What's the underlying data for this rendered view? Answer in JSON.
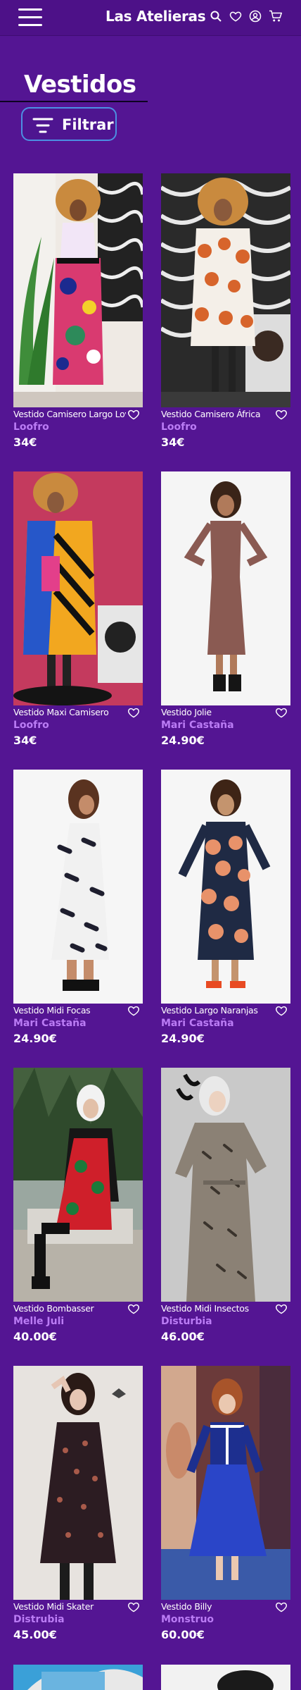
{
  "header": {
    "brand": "Las Atelieras",
    "icons": [
      "menu-icon",
      "search-icon",
      "heart-icon",
      "user-icon",
      "cart-icon"
    ]
  },
  "page": {
    "title": "Vestidos",
    "filter_label": "Filtrar"
  },
  "colors": {
    "background": "#541593",
    "brand_text": "#bb7cf5",
    "filter_border": "#4c90e2"
  },
  "products": [
    {
      "name": "Vestido Camisero Largo Love",
      "brand": "Loofro",
      "price": "34€"
    },
    {
      "name": "Vestido Camisero África",
      "brand": "Loofro",
      "price": "34€"
    },
    {
      "name": "Vestido Maxi Camisero",
      "brand": "Loofro",
      "price": "34€"
    },
    {
      "name": "Vestido Jolie",
      "brand": "Mari Castaña",
      "price": "24.90€"
    },
    {
      "name": "Vestido Midi Focas",
      "brand": "Mari Castaña",
      "price": "24.90€"
    },
    {
      "name": "Vestido Largo Naranjas",
      "brand": "Mari Castaña",
      "price": "24.90€"
    },
    {
      "name": "Vestido Bombasser",
      "brand": "Melle Juli",
      "price": "40.00€"
    },
    {
      "name": "Vestido Midi Insectos",
      "brand": "Disturbia",
      "price": "46.00€"
    },
    {
      "name": "Vestido Midi Skater",
      "brand": "Distrubia",
      "price": "45.00€"
    },
    {
      "name": "Vestido Billy",
      "brand": "Monstruo",
      "price": "60.00€"
    }
  ]
}
